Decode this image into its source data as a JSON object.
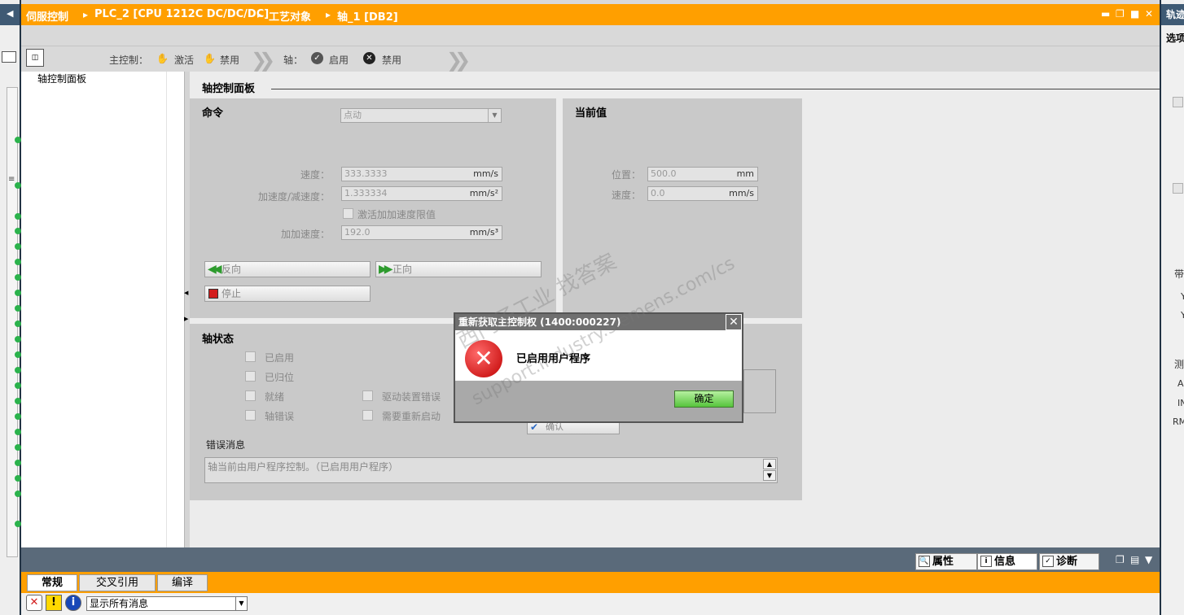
{
  "header": {
    "crumbs": [
      "伺服控制",
      "PLC_2 [CPU 1212C DC/DC/DC]",
      "工艺对象",
      "轴_1 [DB2]"
    ],
    "window_controls": [
      "minimize",
      "restore",
      "maximize",
      "close"
    ]
  },
  "toolbar": {
    "master_control_label": "主控制：",
    "activate_label": "激活",
    "disable_label": "禁用",
    "axis_label": "轴：",
    "enable_label": "启用",
    "axis_disable_label": "禁用"
  },
  "tree": {
    "item": "轴控制面板"
  },
  "main": {
    "title": "轴控制面板",
    "command": {
      "title": "命令",
      "mode_select": "点动",
      "speed_label": "速度：",
      "speed_value": "333.3333",
      "speed_unit": "mm/s",
      "accel_label": "加速度/减速度：",
      "accel_value": "1.333334",
      "accel_unit": "mm/s²",
      "jerk_limit_label": "激活加加速度限值",
      "jerk_label": "加加速度：",
      "jerk_value": "192.0",
      "jerk_unit": "mm/s³",
      "reverse_btn": "反向",
      "forward_btn": "正向",
      "stop_btn": "停止"
    },
    "current": {
      "title": "当前值",
      "position_label": "位置：",
      "position_value": "500.0",
      "position_unit": "mm",
      "speed_label": "速度：",
      "speed_value": "0.0",
      "speed_unit": "mm/s"
    },
    "status": {
      "title": "轴状态",
      "enabled": "已启用",
      "homed": "已归位",
      "ready": "就绪",
      "axis_error": "轴错误",
      "drive_error": "驱动装置错误",
      "restart_required": "需要重新启动",
      "ack_btn": "确认",
      "error_msg_label": "错误消息",
      "error_msg_text": "轴当前由用户程序控制。（已启用用户程序）"
    }
  },
  "dialog": {
    "title": "重新获取主控制权 (1400:000227)",
    "message": "已启用用户程序",
    "ok_label": "确定"
  },
  "bottom": {
    "properties_tab": "属性",
    "info_tab": "信息",
    "diag_tab": "诊断",
    "sub_tabs": [
      "常规",
      "交叉引用",
      "编译"
    ],
    "filter_value": "显示所有消息"
  },
  "right": {
    "title_partial": "轨迹",
    "options_partial": "选项",
    "texts": [
      "带",
      "Y",
      "Y",
      "测",
      "Al",
      "IN",
      "RM"
    ]
  },
  "watermark": {
    "line1": "西门子工业  找答案",
    "line2": "support.industry.siemens.com/cs"
  },
  "colors": {
    "accent": "#ff9f00",
    "panel": "#c9c9c9",
    "ok_green": "#57c43c",
    "error_red": "#d21e1e"
  }
}
